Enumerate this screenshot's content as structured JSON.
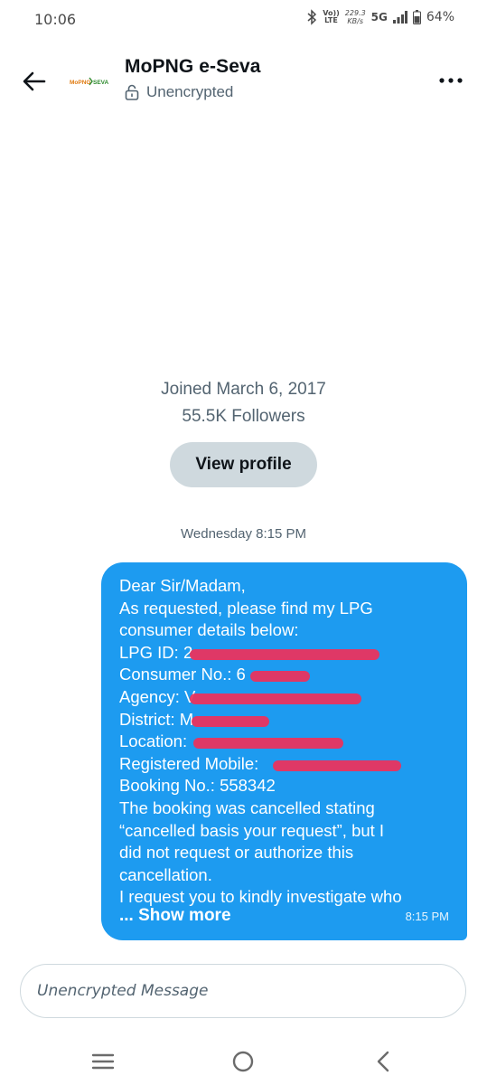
{
  "status_bar": {
    "time": "10:06",
    "volte_top": "Vo))",
    "volte_bottom": "LTE",
    "speed_top": "229.3",
    "speed_bottom": "KB/s",
    "network": "5G",
    "battery": "64%",
    "icons": [
      "bluetooth-icon",
      "signal-icon",
      "battery-icon"
    ]
  },
  "header": {
    "title": "MoPNG e-Seva",
    "encryption_status": "Unencrypted",
    "avatar_text": "MoPNG e-SEVA",
    "icons": [
      "back-arrow-icon",
      "lock-open-icon",
      "more-options-icon"
    ]
  },
  "profile": {
    "joined": "Joined March 6, 2017",
    "followers": "55.5K Followers",
    "view_profile_label": "View profile"
  },
  "conversation": {
    "day_stamp": "Wednesday 8:15 PM",
    "message": {
      "lines": [
        "Dear Sir/Madam,",
        "As requested, please find my LPG",
        "consumer details below:",
        "LPG ID: 2",
        "Consumer No.: 6",
        "Agency: V",
        "District: M",
        "Location:",
        "Registered Mobile:",
        "Booking No.: 558342",
        "The booking was cancelled stating",
        "“cancelled basis your request”, but I",
        "did not request or authorize this",
        "cancellation.",
        "I request you to kindly investigate who"
      ],
      "show_more_label": "... Show more",
      "time": "8:15 PM",
      "bubble_color": "#1d9bf0"
    }
  },
  "composer": {
    "placeholder": "Unencrypted Message"
  },
  "navbar": {
    "icons": [
      "recent-apps-icon",
      "home-icon",
      "back-nav-icon"
    ]
  },
  "colors": {
    "accent": "#1d9bf0",
    "muted_text": "#536471",
    "redaction": "#f0305a",
    "button_bg": "#cfd9de"
  }
}
